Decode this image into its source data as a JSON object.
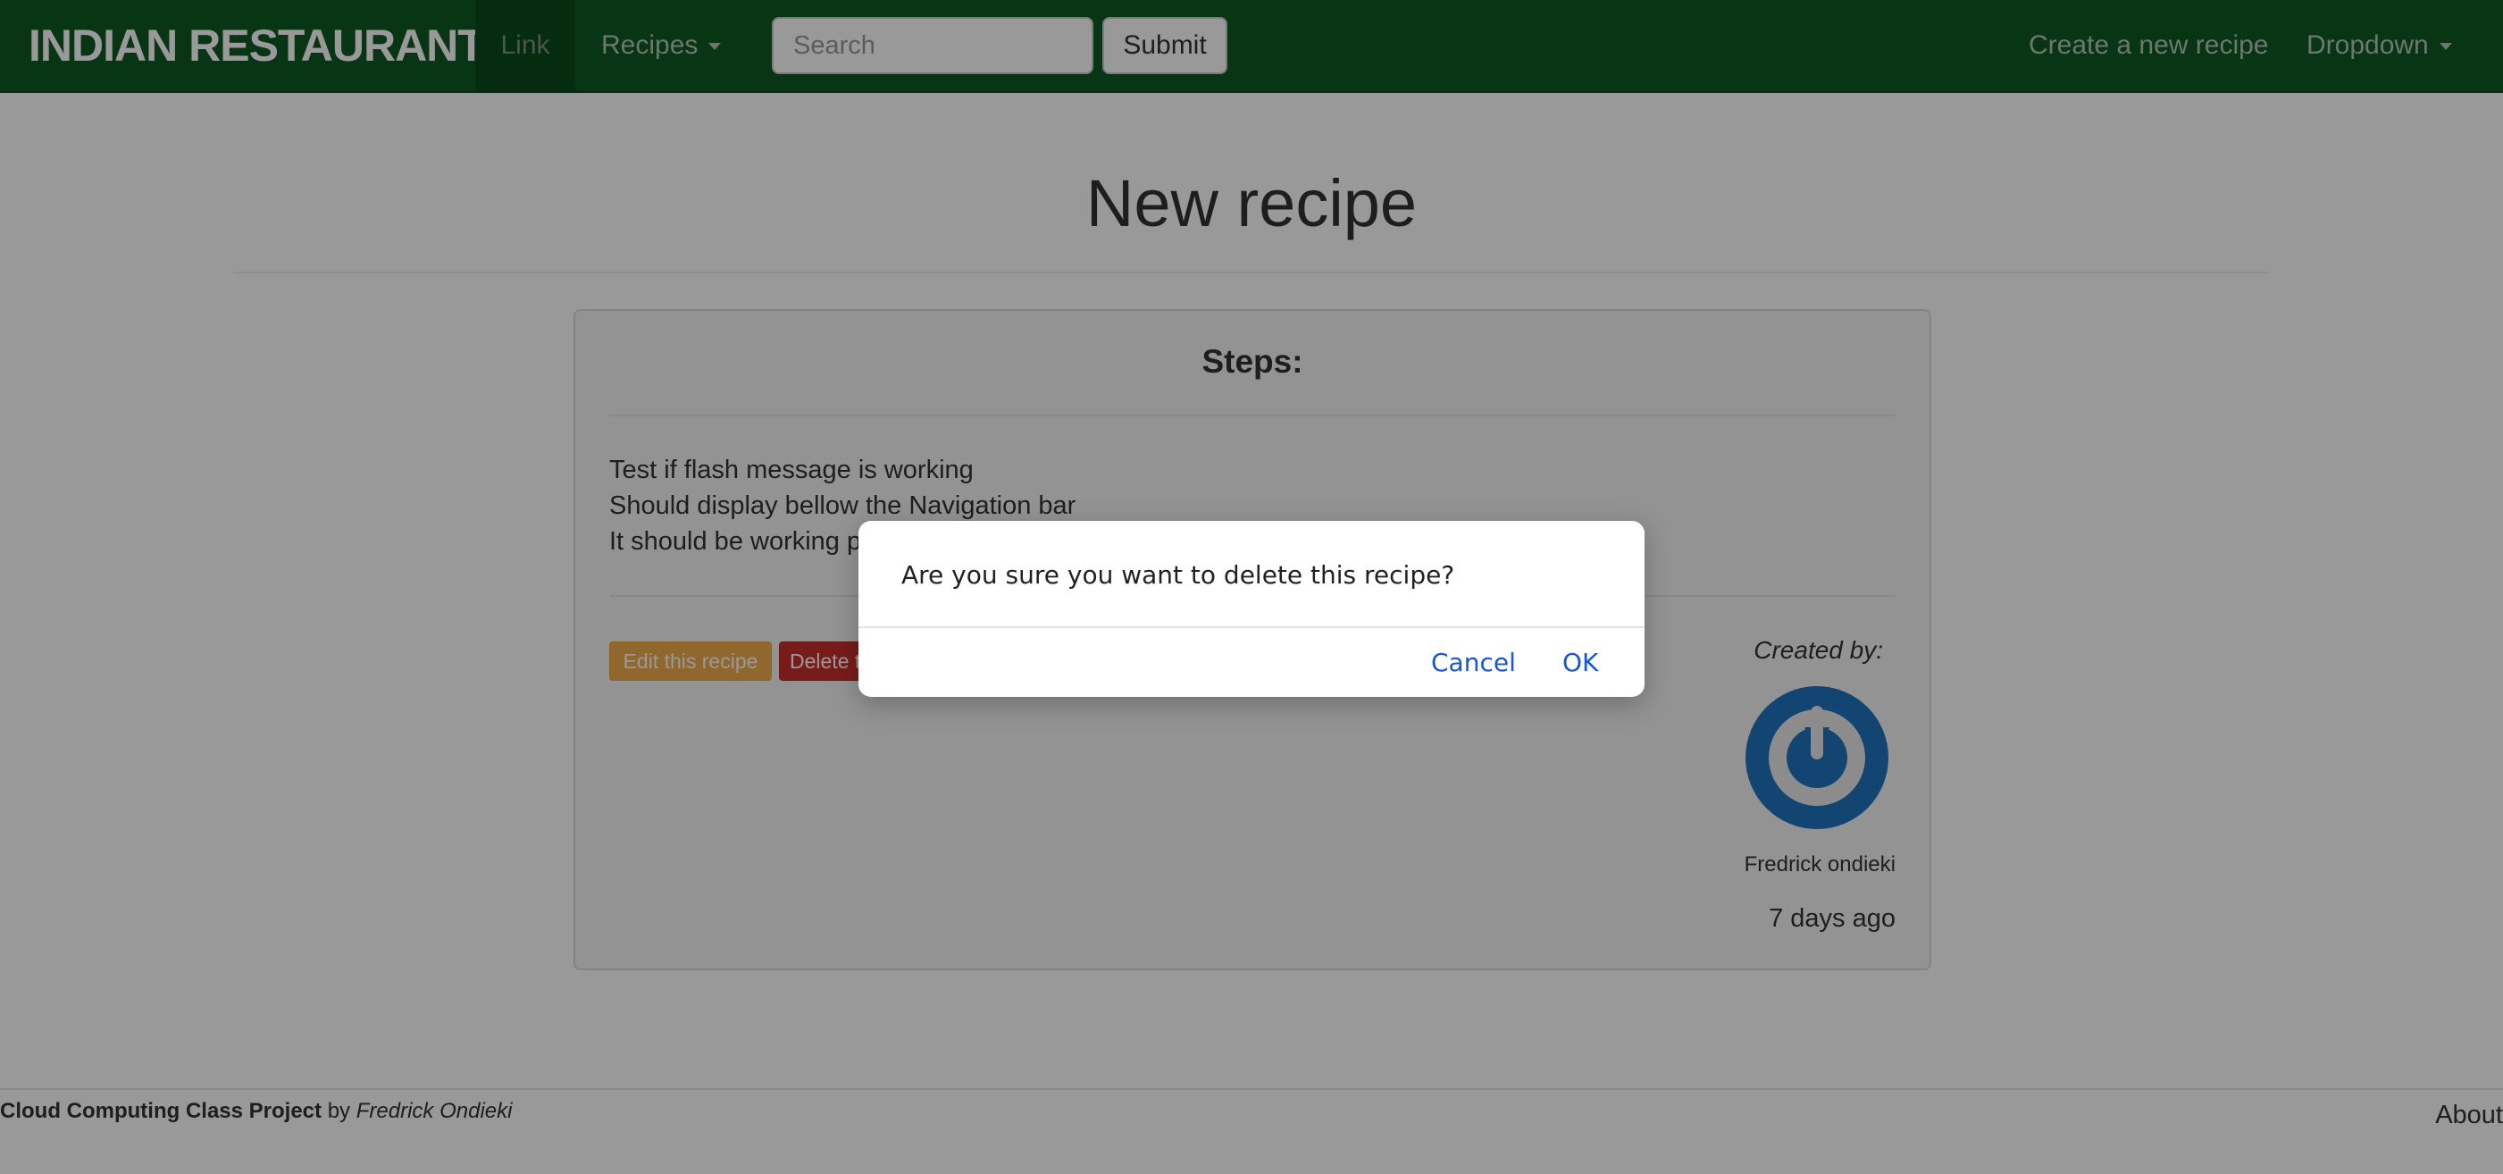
{
  "navbar": {
    "brand": "INDIAN RESTAURANT",
    "link_label": "Link",
    "recipes_label": "Recipes",
    "search_placeholder": "Search",
    "submit_label": "Submit",
    "create_label": "Create a new recipe",
    "dropdown_label": "Dropdown"
  },
  "main": {
    "title": "New recipe",
    "steps_heading": "Steps:",
    "steps": [
      "Test if flash message is working",
      "Should display bellow the Navigation bar",
      "It should be working properly"
    ],
    "edit_label": "Edit this recipe",
    "delete_label": "Delete this recipe",
    "created_by_label": "Created by:",
    "author": "Fredrick ondieki",
    "time_ago": "7 days ago"
  },
  "footer": {
    "project": "Cloud Computing Class Project",
    "by": "by",
    "author": "Fredrick Ondieki",
    "about": "About"
  },
  "dialog": {
    "message": "Are you sure you want to delete this recipe?",
    "cancel_label": "Cancel",
    "ok_label": "OK"
  },
  "colors": {
    "navbar": "#0e5a24",
    "edit_button": "#f0ad4e",
    "delete_button": "#c9302c",
    "dialog_button": "#1a55d6",
    "avatar": "#1e73be"
  },
  "icons": {
    "avatar": "power-icon",
    "caret": "caret-down-icon"
  }
}
